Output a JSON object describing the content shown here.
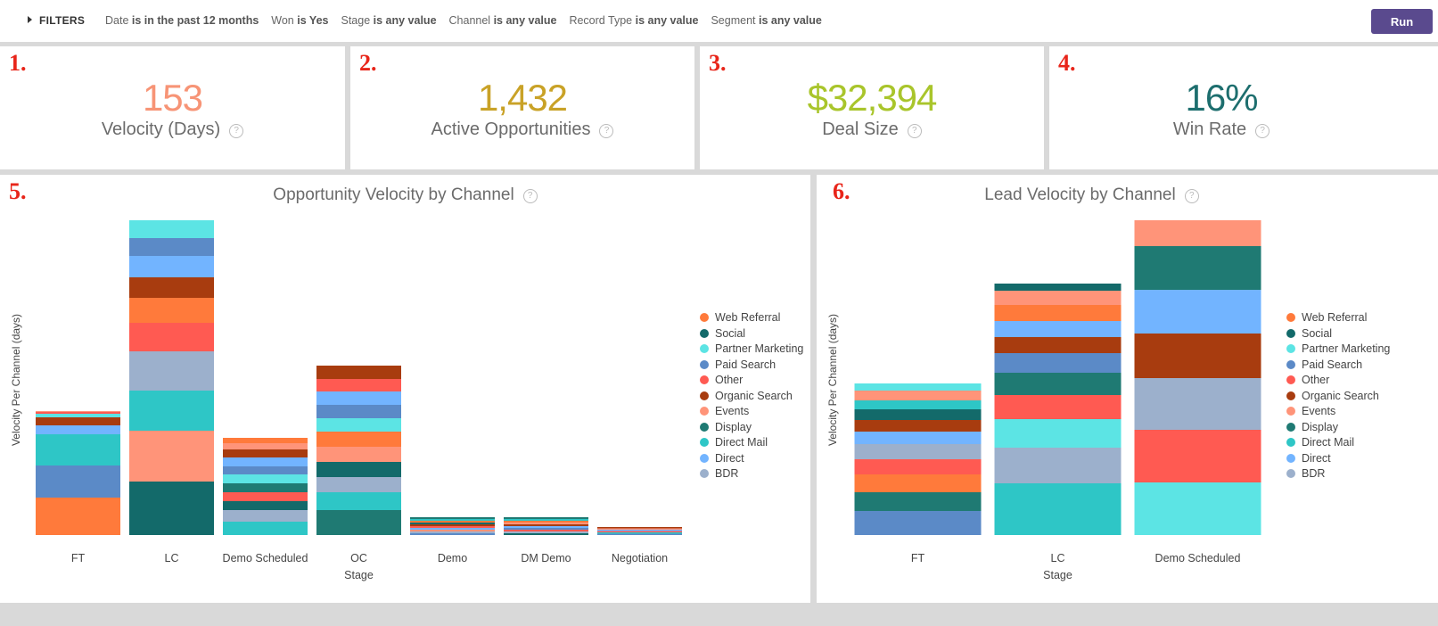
{
  "filters": {
    "toggle_label": "FILTERS",
    "items": [
      {
        "field": "Date",
        "op": "is in the past 12 months"
      },
      {
        "field": "Won",
        "op": "is Yes"
      },
      {
        "field": "Stage",
        "op": "is any value"
      },
      {
        "field": "Channel",
        "op": "is any value"
      },
      {
        "field": "Record Type",
        "op": "is any value"
      },
      {
        "field": "Segment",
        "op": "is any value"
      }
    ],
    "run_label": "Run"
  },
  "kpis": [
    {
      "number": "1.",
      "value": "153",
      "label": "Velocity (Days)",
      "color": "#f79476"
    },
    {
      "number": "2.",
      "value": "1,432",
      "label": "Active Opportunities",
      "color": "#c9a227"
    },
    {
      "number": "3.",
      "value": "$32,394",
      "label": "Deal Size",
      "color": "#a9c52b"
    },
    {
      "number": "4.",
      "value": "16%",
      "label": "Win Rate",
      "color": "#1d6e6e"
    }
  ],
  "help_glyph": "?",
  "legend": [
    {
      "name": "Web Referral",
      "color": "#ff7a3b"
    },
    {
      "name": "Social",
      "color": "#136a6a"
    },
    {
      "name": "Partner Marketing",
      "color": "#5ce4e4"
    },
    {
      "name": "Paid Search",
      "color": "#5b8ac7"
    },
    {
      "name": "Other",
      "color": "#ff5a52"
    },
    {
      "name": "Organic Search",
      "color": "#a83c0f"
    },
    {
      "name": "Events",
      "color": "#ff9479"
    },
    {
      "name": "Display",
      "color": "#1f7a73"
    },
    {
      "name": "Direct Mail",
      "color": "#2ec6c6"
    },
    {
      "name": "Direct",
      "color": "#72b4ff"
    },
    {
      "name": "BDR",
      "color": "#9cb0cc"
    }
  ],
  "chart_data": [
    {
      "type": "bar",
      "number": "5.",
      "title": "Opportunity Velocity by Channel",
      "xlabel": "Stage",
      "ylabel": "Velocity Per Channel (days)",
      "ylim": [
        0,
        350
      ],
      "categories": [
        "FT",
        "LC",
        "Demo Scheduled",
        "OC",
        "Demo",
        "DM Demo",
        "Negotiation"
      ],
      "stacks": [
        [
          [
            "Web Referral",
            42
          ],
          [
            "Paid Search",
            36
          ],
          [
            "Direct Mail",
            35
          ],
          [
            "Direct",
            10
          ],
          [
            "Organic Search",
            9
          ],
          [
            "Partner Marketing",
            4
          ],
          [
            "Other",
            2
          ],
          [
            "Events",
            1
          ]
        ],
        [
          [
            "Social",
            60
          ],
          [
            "Events",
            57
          ],
          [
            "Direct Mail",
            45
          ],
          [
            "BDR",
            44
          ],
          [
            "Other",
            32
          ],
          [
            "Web Referral",
            28
          ],
          [
            "Organic Search",
            23
          ],
          [
            "Direct",
            24
          ],
          [
            "Paid Search",
            20
          ],
          [
            "Partner Marketing",
            20
          ]
        ],
        [
          [
            "Direct Mail",
            15
          ],
          [
            "BDR",
            13
          ],
          [
            "Social",
            10
          ],
          [
            "Other",
            10
          ],
          [
            "Display",
            10
          ],
          [
            "Partner Marketing",
            10
          ],
          [
            "Paid Search",
            9
          ],
          [
            "Direct",
            10
          ],
          [
            "Organic Search",
            9
          ],
          [
            "Events",
            7
          ],
          [
            "Web Referral",
            6
          ]
        ],
        [
          [
            "Display",
            28
          ],
          [
            "Direct Mail",
            20
          ],
          [
            "BDR",
            17
          ],
          [
            "Social",
            17
          ],
          [
            "Events",
            17
          ],
          [
            "Web Referral",
            17
          ],
          [
            "Partner Marketing",
            15
          ],
          [
            "Paid Search",
            15
          ],
          [
            "Direct",
            15
          ],
          [
            "Other",
            14
          ],
          [
            "Organic Search",
            15
          ]
        ],
        [
          [
            "Paid Search",
            2
          ],
          [
            "BDR",
            2
          ],
          [
            "Events",
            2
          ],
          [
            "Direct",
            2
          ],
          [
            "Other",
            2
          ],
          [
            "Organic Search",
            2
          ],
          [
            "Social",
            2
          ],
          [
            "Web Referral",
            2
          ],
          [
            "Direct Mail",
            2
          ],
          [
            "Display",
            2
          ]
        ],
        [
          [
            "Social",
            2
          ],
          [
            "BDR",
            2
          ],
          [
            "Other",
            2
          ],
          [
            "Paid Search",
            2
          ],
          [
            "Direct",
            2
          ],
          [
            "Organic Search",
            2
          ],
          [
            "Events",
            2
          ],
          [
            "Web Referral",
            2
          ],
          [
            "Direct Mail",
            2
          ],
          [
            "Display",
            2
          ]
        ],
        [
          [
            "Paid Search",
            1.5
          ],
          [
            "Direct Mail",
            1.5
          ],
          [
            "Other",
            1.5
          ],
          [
            "Direct",
            1.5
          ],
          [
            "Events",
            1.5
          ],
          [
            "Organic Search",
            1.5
          ]
        ]
      ]
    },
    {
      "type": "bar",
      "number": "6.",
      "title": "Lead Velocity by Channel",
      "xlabel": "Stage",
      "ylabel": "Velocity Per Channel (days)",
      "ylim": [
        0,
        350
      ],
      "categories": [
        "FT",
        "LC",
        "Demo Scheduled"
      ],
      "stacks": [
        [
          [
            "Paid Search",
            27
          ],
          [
            "Display",
            21
          ],
          [
            "Web Referral",
            20
          ],
          [
            "Other",
            17
          ],
          [
            "BDR",
            17
          ],
          [
            "Direct",
            14
          ],
          [
            "Organic Search",
            13
          ],
          [
            "Social",
            12
          ],
          [
            "Direct Mail",
            10
          ],
          [
            "Events",
            11
          ],
          [
            "Partner Marketing",
            8
          ]
        ],
        [
          [
            "Direct Mail",
            58
          ],
          [
            "BDR",
            40
          ],
          [
            "Partner Marketing",
            32
          ],
          [
            "Other",
            27
          ],
          [
            "Display",
            25
          ],
          [
            "Paid Search",
            22
          ],
          [
            "Organic Search",
            18
          ],
          [
            "Direct",
            18
          ],
          [
            "Web Referral",
            18
          ],
          [
            "Events",
            16
          ],
          [
            "Social",
            8
          ]
        ],
        [
          [
            "Partner Marketing",
            59
          ],
          [
            "Other",
            59
          ],
          [
            "BDR",
            58
          ],
          [
            "Organic Search",
            50
          ],
          [
            "Direct",
            49
          ],
          [
            "Display",
            49
          ],
          [
            "Events",
            29
          ]
        ]
      ]
    }
  ]
}
